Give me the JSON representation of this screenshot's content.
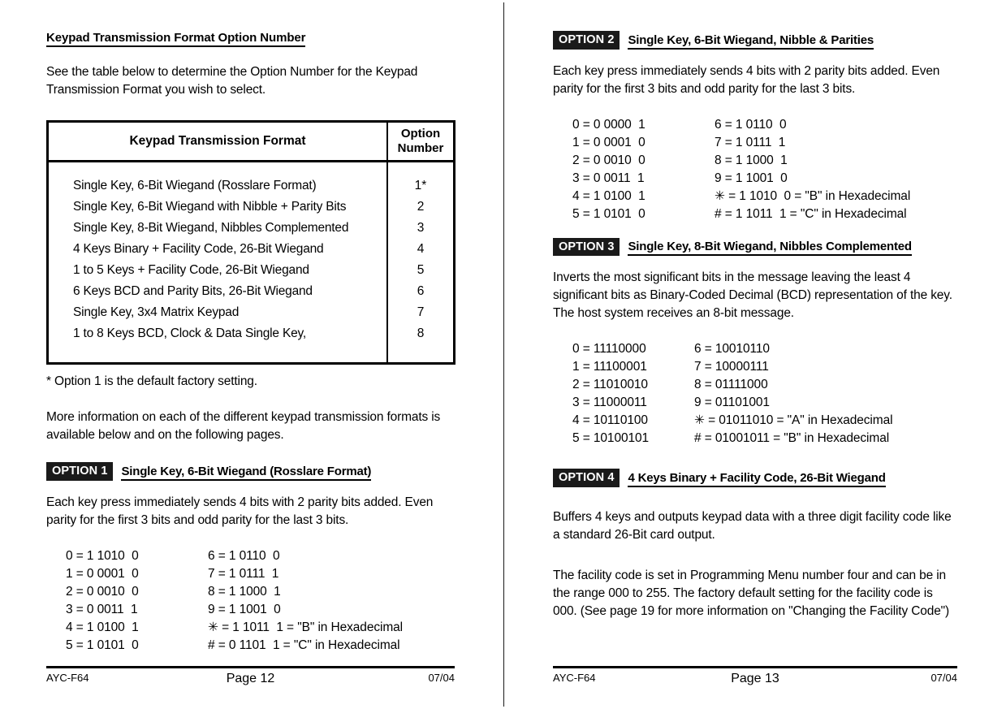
{
  "left_page": {
    "section_title": "Keypad Transmission Format Option Number",
    "intro": "See the table below to determine the Option Number for the Keypad Transmission Format you wish to select.",
    "table": {
      "headers": [
        "Keypad Transmission Format",
        "Option Number"
      ],
      "header_format": "Keypad Transmission Format",
      "header_number_line1": "Option",
      "header_number_line2": "Number",
      "rows": [
        {
          "format": "Single Key, 6-Bit Wiegand (Rosslare Format)",
          "number": "1*"
        },
        {
          "format": "Single Key, 6-Bit Wiegand with Nibble + Parity Bits",
          "number": "2"
        },
        {
          "format": "Single Key, 8-Bit Wiegand, Nibbles Complemented",
          "number": "3"
        },
        {
          "format": "4 Keys Binary + Facility Code, 26-Bit Wiegand",
          "number": "4"
        },
        {
          "format": "1 to 5 Keys + Facility Code, 26-Bit Wiegand",
          "number": "5"
        },
        {
          "format": "6 Keys BCD and Parity Bits, 26-Bit Wiegand",
          "number": "6"
        },
        {
          "format": "Single Key, 3x4 Matrix Keypad",
          "number": "7"
        },
        {
          "format": "1 to 8 Keys BCD, Clock & Data Single Key,",
          "number": "8"
        }
      ]
    },
    "footnote": "* Option 1 is the default factory setting.",
    "more_info": "More information on each of the different keypad transmission formats is available below and on the following pages.",
    "option1": {
      "badge": "OPTION 1",
      "title": "Single Key, 6-Bit Wiegand (Rosslare Format)",
      "description": "Each key press immediately sends 4 bits with 2 parity bits added. Even parity for the first 3 bits and odd parity for the last 3 bits.",
      "codes_col1": [
        "0 = 1 1010  0",
        "1 = 0 0001  0",
        "2 = 0 0010  0",
        "3 = 0 0011  1",
        "4 = 1 0100  1",
        "5 = 1 0101  0"
      ],
      "codes_col2": [
        "6 = 1 0110  0",
        "7 = 1 0111  1",
        "8 = 1 1000  1",
        "9 = 1 1001  0",
        "✳ = 1 1011  1 = \"B\" in Hexadecimal",
        "# = 0 1101  1 = \"C\" in Hexadecimal"
      ]
    },
    "footer": {
      "left": "AYC-F64",
      "center": "Page 12",
      "right": "07/04"
    }
  },
  "right_page": {
    "option2": {
      "badge": "OPTION 2",
      "title": "Single Key, 6-Bit Wiegand, Nibble & Parities",
      "description": "Each key press immediately sends 4 bits with 2 parity bits added. Even parity for the first 3 bits and odd parity for the last 3 bits.",
      "codes_col1": [
        "0 = 0 0000  1",
        "1 = 0 0001  0",
        "2 = 0 0010  0",
        "3 = 0 0011  1",
        "4 = 1 0100  1",
        "5 = 1 0101  0"
      ],
      "codes_col2": [
        "6 = 1 0110  0",
        "7 = 1 0111  1",
        "8 = 1 1000  1",
        "9 = 1 1001  0",
        "✳ = 1 1010  0 = \"B\" in Hexadecimal",
        "# = 1 1011  1 = \"C\" in Hexadecimal"
      ]
    },
    "option3": {
      "badge": "OPTION 3",
      "title": "Single Key, 8-Bit Wiegand, Nibbles Complemented",
      "description": "Inverts the most significant bits in the message leaving the least 4 significant bits as Binary-Coded Decimal (BCD) representation of the key. The host system receives an 8-bit message.",
      "codes_col1": [
        "0 = 11110000",
        "1 = 11100001",
        "2 = 11010010",
        "3 = 11000011",
        "4 = 10110100",
        "5 = 10100101"
      ],
      "codes_col2": [
        "6 = 10010110",
        "7 = 10000111",
        "8 = 01111000",
        "9 = 01101001",
        "✳ = 01011010 = \"A\" in Hexadecimal",
        "# = 01001011 = \"B\" in Hexadecimal"
      ]
    },
    "option4": {
      "badge": "OPTION 4",
      "title": "4 Keys Binary + Facility Code, 26-Bit Wiegand",
      "paragraph1": "Buffers 4 keys and outputs keypad data with a three digit facility code like a standard 26-Bit card output.",
      "paragraph2": "The facility code is set in Programming Menu number four and can be in the range 000 to 255. The factory default setting for the facility code is 000. (See page 19 for more information on \"Changing the Facility Code\")"
    },
    "footer": {
      "left": "AYC-F64",
      "center": "Page 13",
      "right": "07/04"
    }
  }
}
